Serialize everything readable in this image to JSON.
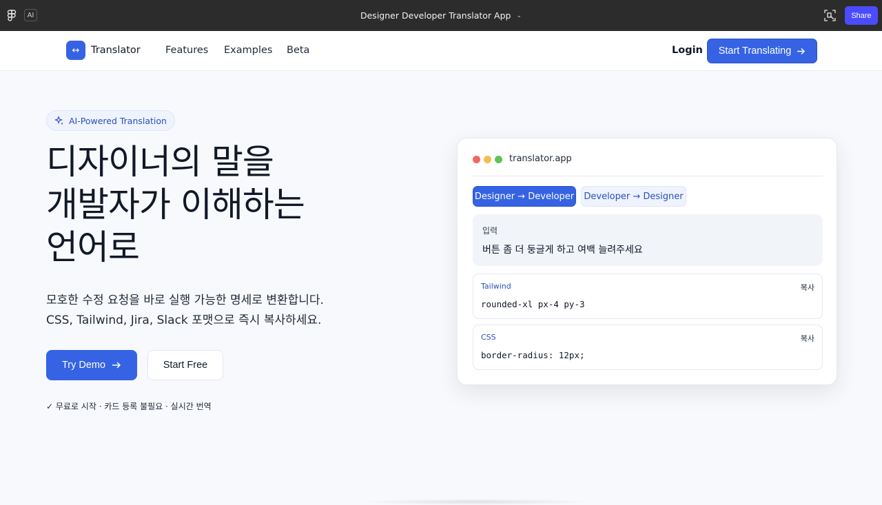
{
  "appbar": {
    "ai_label": "AI",
    "title": "Designer Developer Translator App",
    "share_label": "Share"
  },
  "nav": {
    "brand": "Translator",
    "logo_glyph": "↔",
    "links": [
      "Features",
      "Examples",
      "Beta"
    ],
    "login_label": "Login",
    "cta_label": "Start Translating"
  },
  "hero": {
    "badge": "AI-Powered Translation",
    "headline": [
      "디자이너의 말을",
      "개발자가 이해하는",
      "언어로"
    ],
    "subtext": [
      "모호한 수정 요청을 바로 실행 가능한 명세로 변환합니다.",
      "CSS, Tailwind, Jira, Slack 포맷으로 즉시 복사하세요."
    ],
    "primary_button": "Try Demo",
    "secondary_button": "Start Free",
    "footnote": "✓ 무료로 시작 · 카드 등록 불필요 · 실시간 번역"
  },
  "card": {
    "url": "translator.app",
    "tabs": [
      "Designer → Developer",
      "Developer → Designer"
    ],
    "input_label": "입력",
    "input_value": "버튼 좀 더 둥글게 하고 여백 늘려주세요",
    "outputs": [
      {
        "format": "Tailwind",
        "copy_label": "복사",
        "code": "rounded-xl px-4 py-3"
      },
      {
        "format": "CSS",
        "copy_label": "복사",
        "code": "border-radius: 12px;"
      }
    ]
  },
  "colors": {
    "accent": "#3563e4",
    "share": "#4b4bff",
    "dot_red": "#ee6a5f",
    "dot_yellow": "#f5bd4f",
    "dot_green": "#61c454"
  }
}
